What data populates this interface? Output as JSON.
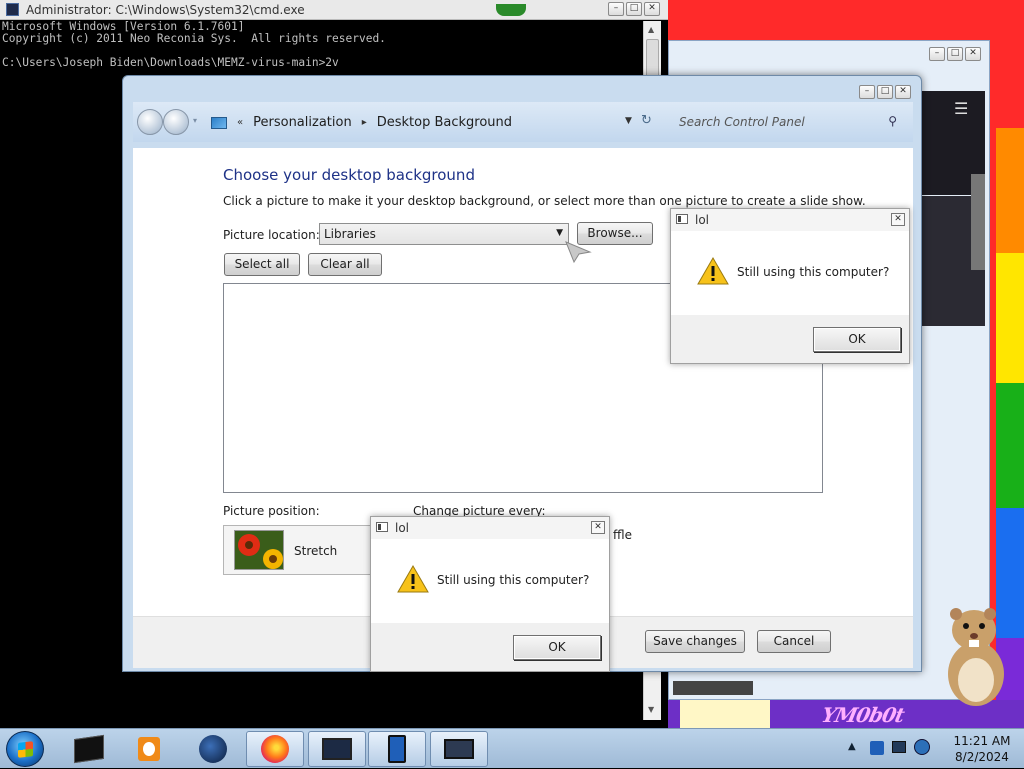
{
  "cmd": {
    "title": "Administrator: C:\\Windows\\System32\\cmd.exe",
    "lines": [
      "Microsoft Windows [Version 6.1.7601]",
      "Copyright (c) 2011 Neo Reconia Sys.  All rights reserved.",
      "",
      "C:\\Users\\Joseph Biden\\Downloads\\MEMZ-virus-main>2v"
    ]
  },
  "control_panel": {
    "breadcrumb": [
      "Personalization",
      "Desktop Background"
    ],
    "search_placeholder": "Search Control Panel",
    "heading": "Choose your desktop background",
    "subtext": "Click a picture to make it your desktop background, or select more than one picture to create a slide show.",
    "picture_location_label": "Picture location:",
    "picture_location_value": "Libraries",
    "browse_label": "Browse...",
    "select_all_label": "Select all",
    "clear_all_label": "Clear all",
    "picture_position_label": "Picture position:",
    "picture_position_value": "Stretch",
    "change_picture_label": "Change picture every:",
    "shuffle_label": "ffle",
    "save_label": "Save changes",
    "cancel_label": "Cancel"
  },
  "dialogs": [
    {
      "title": "lol",
      "message": "Still using this computer?",
      "ok_label": "OK"
    },
    {
      "title": "lol",
      "message": "Still using this computer?",
      "ok_label": "OK"
    }
  ],
  "background": {
    "memz_text": "YM0b0t",
    "rainbow_colors": [
      "#ff2a2a",
      "#ff8a00",
      "#ffe600",
      "#18b018",
      "#1a6ef0",
      "#7a2ad8"
    ]
  },
  "taskbar": {
    "time": "11:21 AM",
    "date": "8/2/2024",
    "items": [
      "terminal-app",
      "media-player",
      "globe-app",
      "firefox",
      "window-app",
      "tablet-app",
      "monitor-app"
    ]
  }
}
